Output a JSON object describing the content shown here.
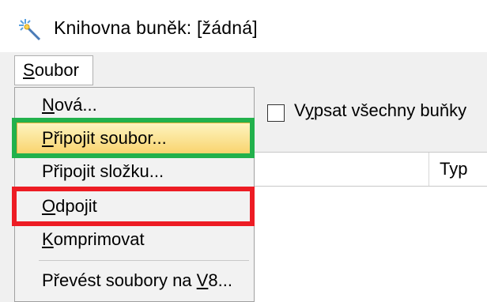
{
  "window": {
    "title": "Knihovna buněk: [žádná]",
    "icon": "wand-sparkle-icon"
  },
  "menubar": {
    "menu_label_first": "S",
    "menu_label_rest": "oubor"
  },
  "menu": {
    "items": [
      {
        "pre": "",
        "accel": "N",
        "post": "ová..."
      },
      {
        "pre": "",
        "accel": "P",
        "post": "řipojit soubor...",
        "highlighted": true
      },
      {
        "pre": "Připo",
        "accel": "j",
        "post": "it složku..."
      },
      {
        "pre": "",
        "accel": "O",
        "post": "dpojit"
      },
      {
        "pre": "",
        "accel": "K",
        "post": "omprimovat"
      },
      {
        "pre": "Převést soubory na ",
        "accel": "V",
        "post": "8..."
      }
    ]
  },
  "panel": {
    "checkbox_pre": "V",
    "checkbox_accel": "y",
    "checkbox_post": "psat všechny buňky",
    "checkbox_checked": false,
    "column_type": "Typ"
  },
  "annotations": {
    "green": "#22b14c",
    "red": "#ed1c24"
  }
}
